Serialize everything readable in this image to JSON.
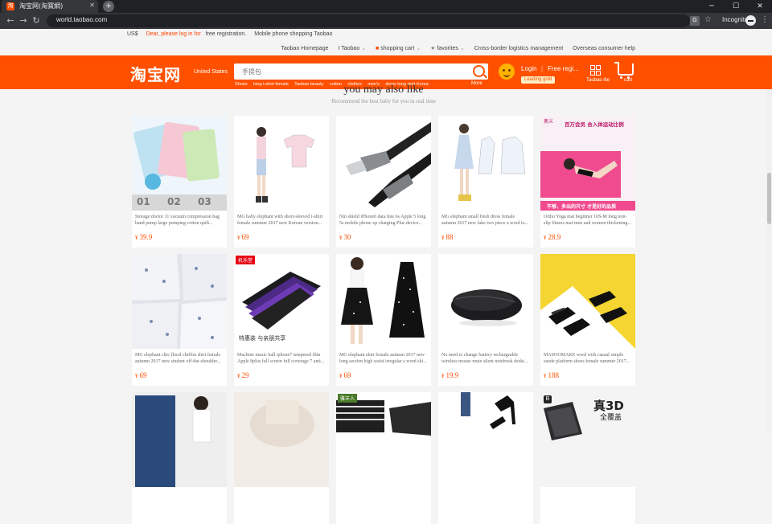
{
  "browser": {
    "tab_title": "淘宝网(淘寶網)",
    "tab_favicon": "淘",
    "url": "world.taobao.com",
    "mode_label": "Incognito"
  },
  "topbar": {
    "currency": "US$",
    "login_prompt": "Dear, please log in for",
    "free_registration": "free registration.",
    "mobile_shopping": "Mobile phone shopping Taobao",
    "links": [
      "Taobao Homepage",
      "I Taobao",
      "shopping cart",
      "favorites",
      "Cross-border logistics management",
      "Overseas consumer help"
    ]
  },
  "header": {
    "logo": "淘宝网",
    "region": "United States",
    "search_placeholder": "手提包",
    "search_more": "More",
    "hot_searches": [
      "Shoes",
      "long t-shirt female",
      "Taobao beauty",
      "cotton",
      "clothes",
      "men's",
      "dress long skirt Korea"
    ],
    "login": "Login",
    "divider": "|",
    "register": "Free regi...",
    "gold_badge": "Leading gold",
    "lite_label": "Taobao lite",
    "cart_label": "cart"
  },
  "section": {
    "title": "you may also like",
    "subtitle": "Recommend the best baby for you in real time"
  },
  "currency_symbol": "¥",
  "products": [
    {
      "title": "Storage doctor 11 vacuum compression bag hand pump large pumping cotton quilt...",
      "price": "39.9",
      "image_label": "vacuum-bags-image",
      "thumb_text": [
        "01",
        "02",
        "03"
      ]
    },
    {
      "title": "MG baby elephant with short-sleeved t-shirt female summer 2017 new Korean version...",
      "price": "69",
      "image_label": "tshirt-outfit-image"
    },
    {
      "title": "Nin shield iPhone6 data line 6s Apple 5 long 5s mobile phone xp charging Plus device...",
      "price": "30",
      "image_label": "charging-cable-image"
    },
    {
      "title": "MG elephant small fresh dress female autumn 2017 new fake two piece a word to...",
      "price": "88",
      "image_label": "dress-sketch-image"
    },
    {
      "title": "Ortho Yoga mat beginner 10S-M long non-slip fitness mat men and women thickening...",
      "price": "28.9",
      "image_label": "yoga-mat-image",
      "thumb_text": [
        "奥义",
        "百万会员 合入体运动比例",
        "不够，多出的尺寸 才是好的品质"
      ]
    },
    {
      "title": "MG elephant chic floral chiffon shirt female autumn 2017 new student off-the-shoulder...",
      "price": "69",
      "image_label": "floral-shirt-image"
    },
    {
      "title": "Machine music hall iphone7 tempered film Apple 8plus full screen full coverage 7 anti...",
      "price": "29",
      "image_label": "tempered-film-image",
      "thumb_text": [
        "机乐堂",
        "特惠装 与亲朋共享"
      ]
    },
    {
      "title": "MG elephant skirt female autumn 2017 new long section high waist irregular a word ski...",
      "price": "69",
      "image_label": "skirt-image"
    },
    {
      "title": "No need to change battery rechargeable wireless mouse mute silent notebook deskt...",
      "price": "19.9",
      "image_label": "wireless-mouse-image"
    },
    {
      "title": "MASOOMAKE word with casual simple suede platform shoes female summer 2017...",
      "price": "188",
      "image_label": "platform-shoes-image"
    },
    {
      "title": "",
      "price": "",
      "image_label": "jeans-image"
    },
    {
      "title": "",
      "price": "",
      "image_label": "knitwear-image"
    },
    {
      "title": "",
      "price": "",
      "image_label": "fashion-tee-image",
      "thumb_text": [
        "雅羊人"
      ]
    },
    {
      "title": "",
      "price": "",
      "image_label": "heels-image"
    },
    {
      "title": "",
      "price": "",
      "image_label": "screen-protector-3d-image",
      "thumb_text": [
        "B",
        "真3D",
        "全覆盖"
      ]
    }
  ],
  "colors": {
    "brand_orange": "#ff5000",
    "price_red": "#ff5000",
    "page_bg": "#f4f4f4",
    "chrome_dark": "#202124"
  }
}
